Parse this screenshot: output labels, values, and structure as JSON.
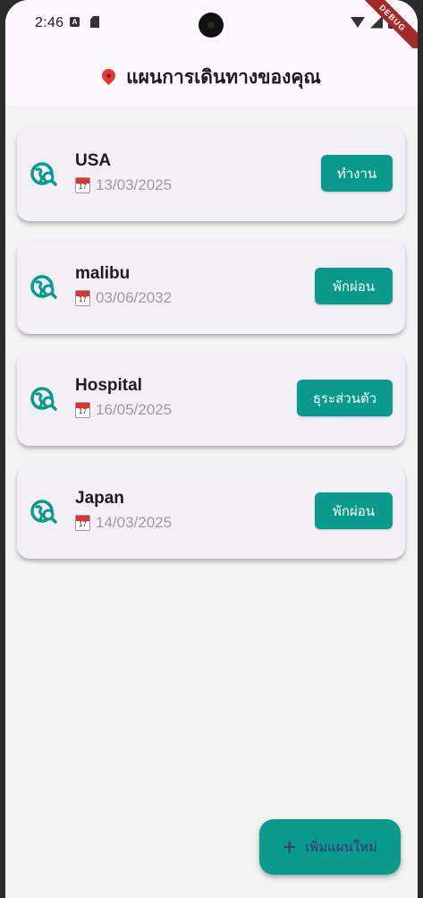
{
  "status_bar": {
    "time": "2:46"
  },
  "debug_ribbon": "DEBUG",
  "app_bar": {
    "title": "แผนการเดินทางของคุณ"
  },
  "trips": [
    {
      "name": "USA",
      "date": "13/03/2025",
      "category": "ทำงาน"
    },
    {
      "name": "malibu",
      "date": "03/06/2032",
      "category": "พักผ่อน"
    },
    {
      "name": "Hospital",
      "date": "16/05/2025",
      "category": "ธุระส่วนตัว"
    },
    {
      "name": "Japan",
      "date": "14/03/2025",
      "category": "พักผ่อน"
    }
  ],
  "fab": {
    "label": "เพิ่มแผนใหม่"
  },
  "colors": {
    "accent": "#0a9a8c",
    "fab_text": "#3b2f7a",
    "background": "#f3f3f4",
    "card": "#f3eff6"
  }
}
